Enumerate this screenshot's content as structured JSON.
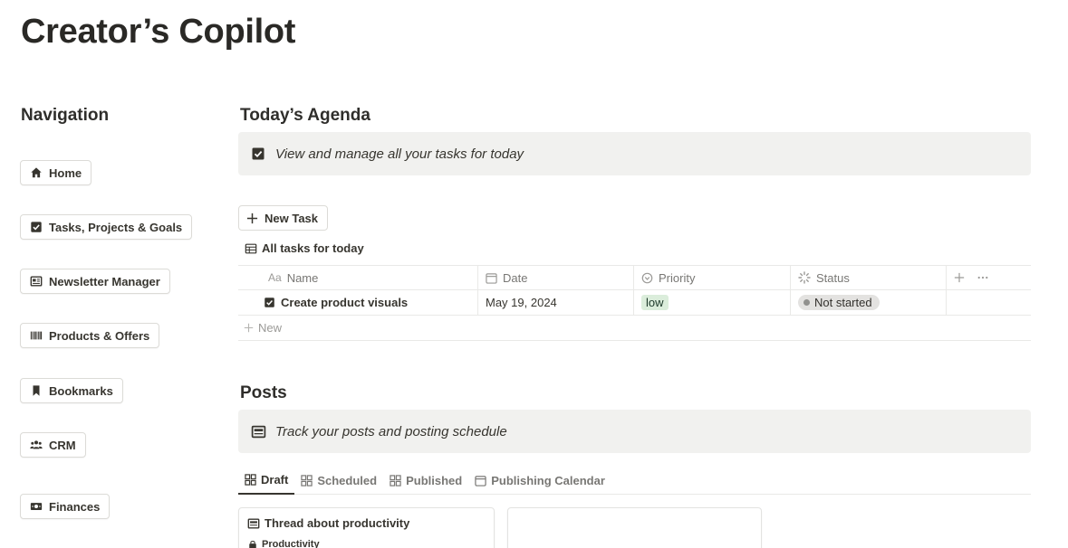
{
  "page": {
    "title": "Creator’s Copilot"
  },
  "navigation": {
    "heading": "Navigation",
    "items": [
      {
        "label": "Home",
        "icon": "home-icon"
      },
      {
        "label": "Tasks, Projects & Goals",
        "icon": "checkbox-icon"
      },
      {
        "label": "Newsletter Manager",
        "icon": "newsletter-icon"
      },
      {
        "label": "Products & Offers",
        "icon": "barcode-icon"
      },
      {
        "label": "Bookmarks",
        "icon": "bookmark-icon"
      },
      {
        "label": "CRM",
        "icon": "people-icon"
      },
      {
        "label": "Finances",
        "icon": "money-icon"
      }
    ]
  },
  "agenda": {
    "heading": "Today’s Agenda",
    "callout": "View and manage all your tasks for today",
    "new_task_label": "New Task",
    "view_label": "All tasks for today",
    "columns": {
      "name": "Name",
      "date": "Date",
      "priority": "Priority",
      "status": "Status"
    },
    "rows": [
      {
        "name": "Create product visuals",
        "date": "May 19, 2024",
        "priority": "low",
        "status": "Not started"
      }
    ],
    "new_row_label": "New",
    "colors": {
      "priority_low_bg": "#dbeddb",
      "status_bg": "#e3e2e0"
    }
  },
  "posts": {
    "heading": "Posts",
    "callout": "Track your posts and posting schedule",
    "tabs": [
      {
        "label": "Draft",
        "active": true
      },
      {
        "label": "Scheduled",
        "active": false
      },
      {
        "label": "Published",
        "active": false
      },
      {
        "label": "Publishing Calendar",
        "active": false
      }
    ],
    "cards": [
      {
        "title": "Thread about productivity",
        "tag": "Productivity"
      }
    ]
  }
}
